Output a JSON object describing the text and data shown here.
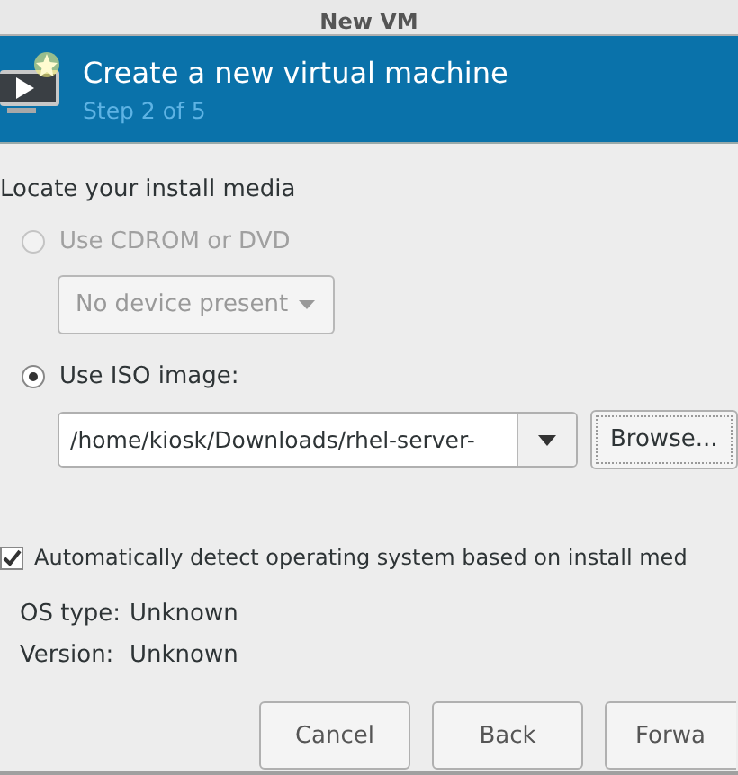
{
  "window": {
    "title": "New VM"
  },
  "header": {
    "title": "Create a new virtual machine",
    "step": "Step 2 of 5"
  },
  "section_label": "Locate your install media",
  "media_options": [
    {
      "kind": "device",
      "label": "Use CDROM or DVD",
      "selected": false,
      "disabled": true,
      "dropdown": "No device present"
    },
    {
      "kind": "iso",
      "label": "Use ISO image:",
      "selected": true,
      "disabled": false,
      "value": "/home/kiosk/Downloads/rhel-server-",
      "browse": "Browse..."
    }
  ],
  "auto_detect": {
    "label": "Automatically detect operating system based on install med",
    "checked": true
  },
  "os_info": [
    {
      "label": "OS type:",
      "value": "Unknown"
    },
    {
      "label": "Version:",
      "value": "Unknown"
    }
  ],
  "buttons": [
    "Cancel",
    "Back",
    "Forwa"
  ]
}
